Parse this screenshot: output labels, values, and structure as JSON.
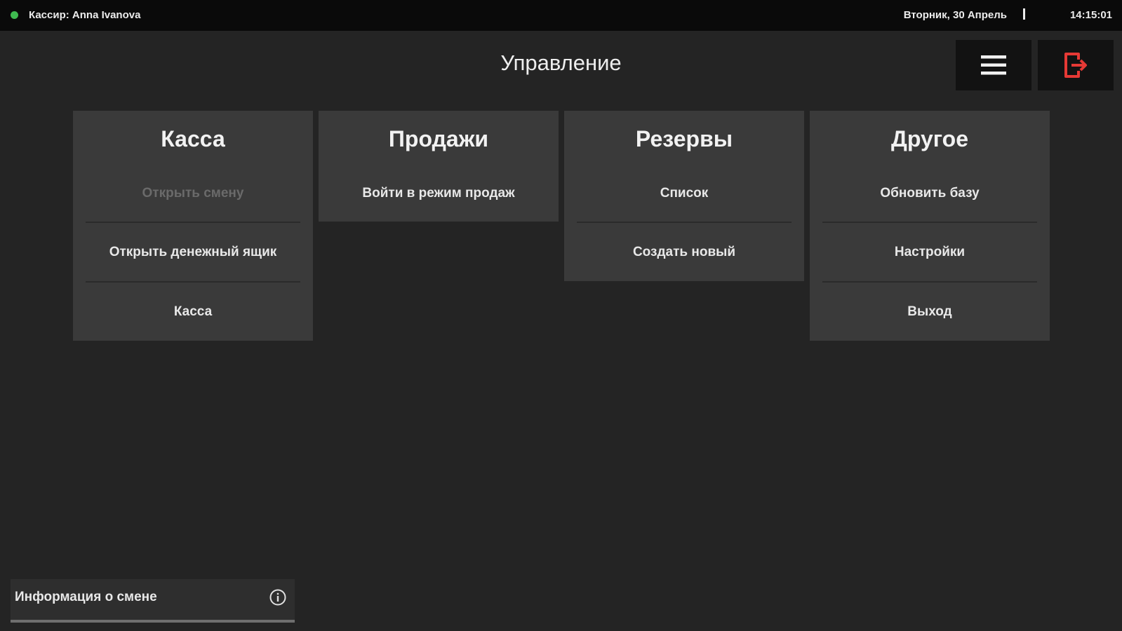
{
  "status_bar": {
    "cashier": "Кассир: Anna Ivanova",
    "date": "Вторник, 30 Апрель",
    "time": "14:15:01",
    "online_color": "#3fb950"
  },
  "header": {
    "title": "Управление",
    "menu_icon": "hamburger-menu-icon",
    "exit_icon": "logout-icon",
    "exit_color": "#e53935"
  },
  "cards": [
    {
      "title": "Касса",
      "items": [
        {
          "label": "Открыть смену",
          "disabled": true
        },
        {
          "label": "Открыть денежный ящик",
          "disabled": false
        },
        {
          "label": "Касса",
          "disabled": false
        }
      ]
    },
    {
      "title": "Продажи",
      "items": [
        {
          "label": "Войти в режим продаж",
          "disabled": false
        }
      ]
    },
    {
      "title": "Резервы",
      "items": [
        {
          "label": "Список",
          "disabled": false
        },
        {
          "label": "Создать новый",
          "disabled": false
        }
      ]
    },
    {
      "title": "Другое",
      "items": [
        {
          "label": "Обновить базу",
          "disabled": false
        },
        {
          "label": "Настройки",
          "disabled": false
        },
        {
          "label": "Выход",
          "disabled": false
        }
      ]
    }
  ],
  "shift_info": {
    "label": "Информация о смене",
    "icon": "info-circle-icon"
  }
}
